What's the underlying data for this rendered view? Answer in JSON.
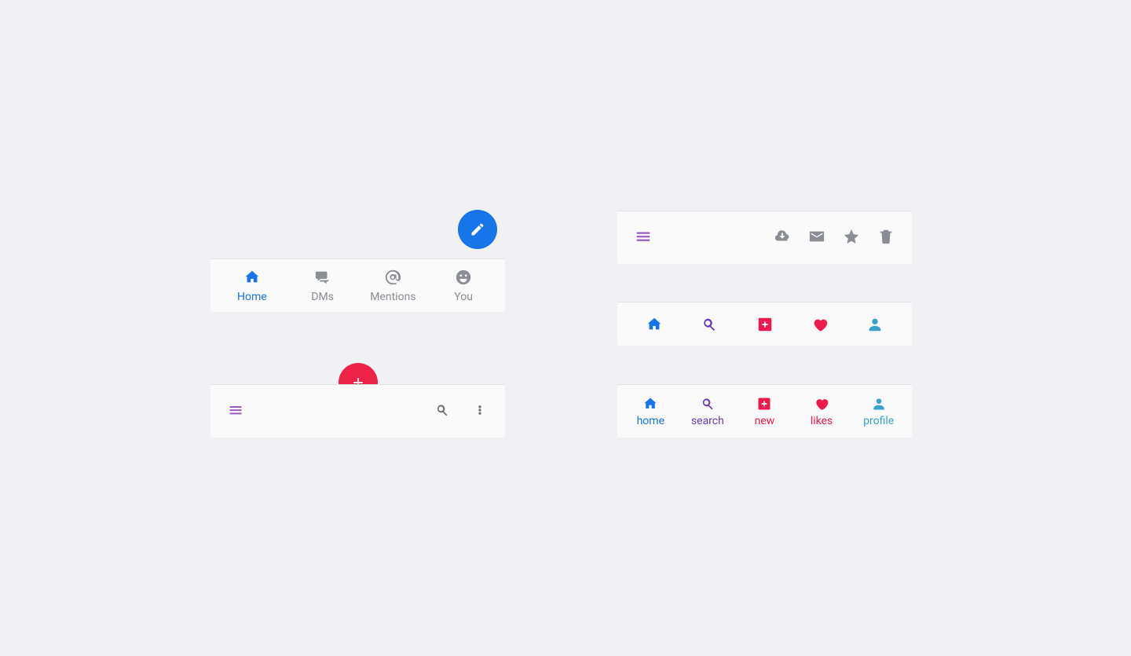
{
  "colors": {
    "blue": "#1774ea",
    "pink": "#ed2249",
    "purple": "#9b5ac1",
    "grey": "#8a8d93",
    "teal": "#3aa1c9",
    "darkpurple": "#6b3ab8"
  },
  "panel1": {
    "fab_color": "#1774ea",
    "tabs": [
      {
        "label": "Home",
        "icon": "home",
        "active": true
      },
      {
        "label": "DMs",
        "icon": "comments",
        "active": false
      },
      {
        "label": "Mentions",
        "icon": "at",
        "active": false
      },
      {
        "label": "You",
        "icon": "smile",
        "active": false
      }
    ]
  },
  "panel2": {
    "fab_color": "#ed2249",
    "left_icon": "menu",
    "right_icons": [
      "search",
      "more-vert"
    ]
  },
  "panel3": {
    "left_icon": "menu",
    "right_icons": [
      "cloud-download",
      "envelope",
      "star",
      "trash"
    ]
  },
  "panel4": {
    "tabs": [
      {
        "icon": "home",
        "color": "blue"
      },
      {
        "icon": "search",
        "color": "darkpurple"
      },
      {
        "icon": "plus-square",
        "color": "pink"
      },
      {
        "icon": "heart",
        "color": "pink"
      },
      {
        "icon": "user",
        "color": "teal"
      }
    ]
  },
  "panel5": {
    "tabs": [
      {
        "icon": "home",
        "label": "home",
        "color": "blue"
      },
      {
        "icon": "search",
        "label": "search",
        "color": "darkpurple"
      },
      {
        "icon": "plus-square",
        "label": "new",
        "color": "pink"
      },
      {
        "icon": "heart",
        "label": "likes",
        "color": "pink"
      },
      {
        "icon": "user",
        "label": "profile",
        "color": "teal"
      }
    ]
  }
}
